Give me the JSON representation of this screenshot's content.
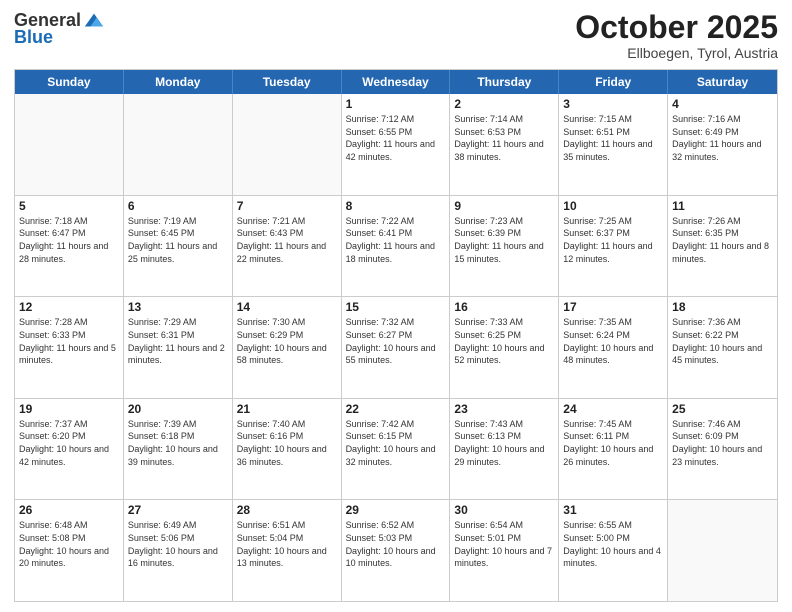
{
  "header": {
    "logo_general": "General",
    "logo_blue": "Blue",
    "title": "October 2025",
    "subtitle": "Ellboegen, Tyrol, Austria"
  },
  "days_of_week": [
    "Sunday",
    "Monday",
    "Tuesday",
    "Wednesday",
    "Thursday",
    "Friday",
    "Saturday"
  ],
  "weeks": [
    [
      {
        "day": "",
        "info": ""
      },
      {
        "day": "",
        "info": ""
      },
      {
        "day": "",
        "info": ""
      },
      {
        "day": "1",
        "info": "Sunrise: 7:12 AM\nSunset: 6:55 PM\nDaylight: 11 hours and 42 minutes."
      },
      {
        "day": "2",
        "info": "Sunrise: 7:14 AM\nSunset: 6:53 PM\nDaylight: 11 hours and 38 minutes."
      },
      {
        "day": "3",
        "info": "Sunrise: 7:15 AM\nSunset: 6:51 PM\nDaylight: 11 hours and 35 minutes."
      },
      {
        "day": "4",
        "info": "Sunrise: 7:16 AM\nSunset: 6:49 PM\nDaylight: 11 hours and 32 minutes."
      }
    ],
    [
      {
        "day": "5",
        "info": "Sunrise: 7:18 AM\nSunset: 6:47 PM\nDaylight: 11 hours and 28 minutes."
      },
      {
        "day": "6",
        "info": "Sunrise: 7:19 AM\nSunset: 6:45 PM\nDaylight: 11 hours and 25 minutes."
      },
      {
        "day": "7",
        "info": "Sunrise: 7:21 AM\nSunset: 6:43 PM\nDaylight: 11 hours and 22 minutes."
      },
      {
        "day": "8",
        "info": "Sunrise: 7:22 AM\nSunset: 6:41 PM\nDaylight: 11 hours and 18 minutes."
      },
      {
        "day": "9",
        "info": "Sunrise: 7:23 AM\nSunset: 6:39 PM\nDaylight: 11 hours and 15 minutes."
      },
      {
        "day": "10",
        "info": "Sunrise: 7:25 AM\nSunset: 6:37 PM\nDaylight: 11 hours and 12 minutes."
      },
      {
        "day": "11",
        "info": "Sunrise: 7:26 AM\nSunset: 6:35 PM\nDaylight: 11 hours and 8 minutes."
      }
    ],
    [
      {
        "day": "12",
        "info": "Sunrise: 7:28 AM\nSunset: 6:33 PM\nDaylight: 11 hours and 5 minutes."
      },
      {
        "day": "13",
        "info": "Sunrise: 7:29 AM\nSunset: 6:31 PM\nDaylight: 11 hours and 2 minutes."
      },
      {
        "day": "14",
        "info": "Sunrise: 7:30 AM\nSunset: 6:29 PM\nDaylight: 10 hours and 58 minutes."
      },
      {
        "day": "15",
        "info": "Sunrise: 7:32 AM\nSunset: 6:27 PM\nDaylight: 10 hours and 55 minutes."
      },
      {
        "day": "16",
        "info": "Sunrise: 7:33 AM\nSunset: 6:25 PM\nDaylight: 10 hours and 52 minutes."
      },
      {
        "day": "17",
        "info": "Sunrise: 7:35 AM\nSunset: 6:24 PM\nDaylight: 10 hours and 48 minutes."
      },
      {
        "day": "18",
        "info": "Sunrise: 7:36 AM\nSunset: 6:22 PM\nDaylight: 10 hours and 45 minutes."
      }
    ],
    [
      {
        "day": "19",
        "info": "Sunrise: 7:37 AM\nSunset: 6:20 PM\nDaylight: 10 hours and 42 minutes."
      },
      {
        "day": "20",
        "info": "Sunrise: 7:39 AM\nSunset: 6:18 PM\nDaylight: 10 hours and 39 minutes."
      },
      {
        "day": "21",
        "info": "Sunrise: 7:40 AM\nSunset: 6:16 PM\nDaylight: 10 hours and 36 minutes."
      },
      {
        "day": "22",
        "info": "Sunrise: 7:42 AM\nSunset: 6:15 PM\nDaylight: 10 hours and 32 minutes."
      },
      {
        "day": "23",
        "info": "Sunrise: 7:43 AM\nSunset: 6:13 PM\nDaylight: 10 hours and 29 minutes."
      },
      {
        "day": "24",
        "info": "Sunrise: 7:45 AM\nSunset: 6:11 PM\nDaylight: 10 hours and 26 minutes."
      },
      {
        "day": "25",
        "info": "Sunrise: 7:46 AM\nSunset: 6:09 PM\nDaylight: 10 hours and 23 minutes."
      }
    ],
    [
      {
        "day": "26",
        "info": "Sunrise: 6:48 AM\nSunset: 5:08 PM\nDaylight: 10 hours and 20 minutes."
      },
      {
        "day": "27",
        "info": "Sunrise: 6:49 AM\nSunset: 5:06 PM\nDaylight: 10 hours and 16 minutes."
      },
      {
        "day": "28",
        "info": "Sunrise: 6:51 AM\nSunset: 5:04 PM\nDaylight: 10 hours and 13 minutes."
      },
      {
        "day": "29",
        "info": "Sunrise: 6:52 AM\nSunset: 5:03 PM\nDaylight: 10 hours and 10 minutes."
      },
      {
        "day": "30",
        "info": "Sunrise: 6:54 AM\nSunset: 5:01 PM\nDaylight: 10 hours and 7 minutes."
      },
      {
        "day": "31",
        "info": "Sunrise: 6:55 AM\nSunset: 5:00 PM\nDaylight: 10 hours and 4 minutes."
      },
      {
        "day": "",
        "info": ""
      }
    ]
  ]
}
